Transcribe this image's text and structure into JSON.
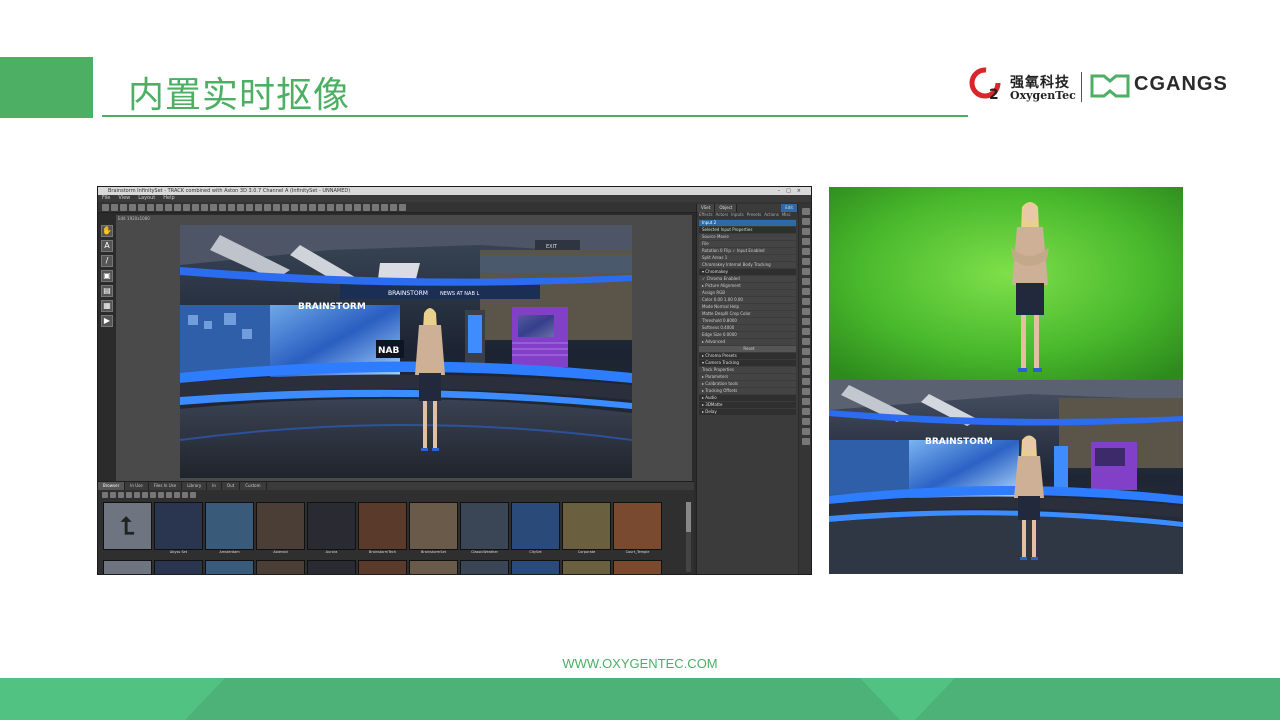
{
  "slide": {
    "title": "内置实时抠像",
    "website": "WWW.OXYGENTEC.COM"
  },
  "logo": {
    "company_cn": "强氧科技",
    "company_en": "OxygenTec",
    "partner": "CGANGS",
    "brand_green": "#4caf64",
    "brand_red": "#d8262b"
  },
  "app": {
    "window_title": "Brainstorm InfinitySet - TRACK combined with Aston 3D 3.0.7 Channel A (InfinitySet - UNNAMED)",
    "menu": [
      "File",
      "View",
      "Layout",
      "Help"
    ],
    "viewport_label": "Edit 1920x1080",
    "set_labels": {
      "brainstorm_left": "BRAINSTORM",
      "brainstorm_top": "BRAINSTORM",
      "nab_banner": "NEWS AT NAB L",
      "nab_logo": "NAB",
      "exit": "EXIT"
    },
    "panel": {
      "tabs": [
        "VSet",
        "Object",
        "Edit"
      ],
      "subtabs": [
        "Effects",
        "Actors",
        "Inputs",
        "Presets",
        "Actions",
        "Misc"
      ],
      "rows": [
        {
          "label": "Input 2",
          "sel": true
        },
        {
          "label": "Selected Input Properties",
          "head": true
        },
        {
          "label": "Source   Movie"
        },
        {
          "label": "File"
        },
        {
          "label": "Rotation  0    Flip  ✓ Input Enabled"
        },
        {
          "label": "Split Areas  1"
        },
        {
          "label": "Chromakey  Internal    Body Tracking"
        },
        {
          "label": "▾ Chromakey",
          "head": true
        },
        {
          "label": "✓ Chroma Enabled"
        },
        {
          "label": "▸ Picture Alignment"
        },
        {
          "label": "Assign  RGB"
        },
        {
          "label": "Color   0.00  1.00  0.00"
        },
        {
          "label": "Mode   Normal   Help"
        },
        {
          "label": "Matte  DespIll  Crop  Color"
        },
        {
          "label": "Threshold 0.8000"
        },
        {
          "label": "Softness 0.4000"
        },
        {
          "label": "Edge Size 0.0000"
        },
        {
          "label": "▸ Advanced"
        },
        {
          "label": "Reset",
          "btn": true
        },
        {
          "label": "▸ Chroma Presets",
          "head": true
        },
        {
          "label": "▾ Camera Tracking",
          "head": true
        },
        {
          "label": "Track Properties"
        },
        {
          "label": "▸ Parameters"
        },
        {
          "label": "▸ Calibration tools"
        },
        {
          "label": "▸ Tracking Offsets"
        },
        {
          "label": "▸ Audio",
          "head": true
        },
        {
          "label": "▸ 3DMatte",
          "head": true
        },
        {
          "label": "▸ Delay",
          "head": true
        }
      ]
    },
    "browser": {
      "tabs": [
        "Browser",
        "In Use",
        "Files In Use",
        "Library",
        "In",
        "Out",
        "Custom"
      ],
      "thumbs": [
        {
          "cap": "",
          "up": true,
          "bg": "#6e7480"
        },
        {
          "cap": "Abyss Set",
          "bg": "#2a3550"
        },
        {
          "cap": "Amsterdam",
          "bg": "#3a5a7a"
        },
        {
          "cap": "Asteroid",
          "bg": "#4a3e36"
        },
        {
          "cap": "Aurora",
          "bg": "#2a2a32"
        },
        {
          "cap": "BrainstormTech",
          "bg": "#5a3a2a"
        },
        {
          "cap": "BrainstormSet",
          "bg": "#6a5a4a"
        },
        {
          "cap": "ClassicWeather",
          "bg": "#3a4656"
        },
        {
          "cap": "CitySet",
          "bg": "#2a4a7a"
        },
        {
          "cap": "Corporate",
          "bg": "#6a6040"
        },
        {
          "cap": "Court_Temple",
          "bg": "#7a4a30"
        }
      ]
    }
  }
}
